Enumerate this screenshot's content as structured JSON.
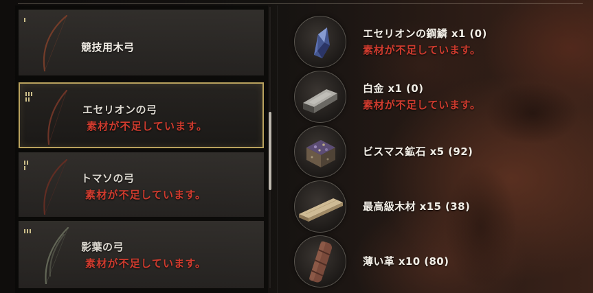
{
  "recipes": [
    {
      "name": "競技用木弓",
      "rank_bars": [
        1
      ],
      "selected": false
    },
    {
      "name": "エセリオンの弓",
      "warning": "素材が不足しています。",
      "rank_bars": [
        3,
        2
      ],
      "selected": true
    },
    {
      "name": "トマソの弓",
      "warning": "素材が不足しています。",
      "rank_bars": [
        2,
        1
      ],
      "selected": false
    },
    {
      "name": "影葉の弓",
      "warning": "素材が不足しています。",
      "rank_bars": [
        3
      ],
      "selected": false
    }
  ],
  "materials": [
    {
      "name": "エセリオンの鋼鱗",
      "required": "x1",
      "owned": "(0)",
      "warning": "素材が不足しています。",
      "icon": "aetherion-steel-scale-icon"
    },
    {
      "name": "白金",
      "required": "x1",
      "owned": "(0)",
      "warning": "素材が不足しています。",
      "icon": "platinum-ingot-icon"
    },
    {
      "name": "ビスマス鉱石",
      "required": "x5",
      "owned": "(92)",
      "icon": "bismuth-ore-icon"
    },
    {
      "name": "最高級木材",
      "required": "x15",
      "owned": "(38)",
      "icon": "finest-lumber-icon"
    },
    {
      "name": "薄い革",
      "required": "x10",
      "owned": "(80)",
      "icon": "thin-leather-icon"
    }
  ],
  "colors": {
    "warning": "#cf3b2e",
    "selected_border": "#b9a25e",
    "text": "#e8e4dc",
    "rank_mark": "#cdbf8a"
  }
}
